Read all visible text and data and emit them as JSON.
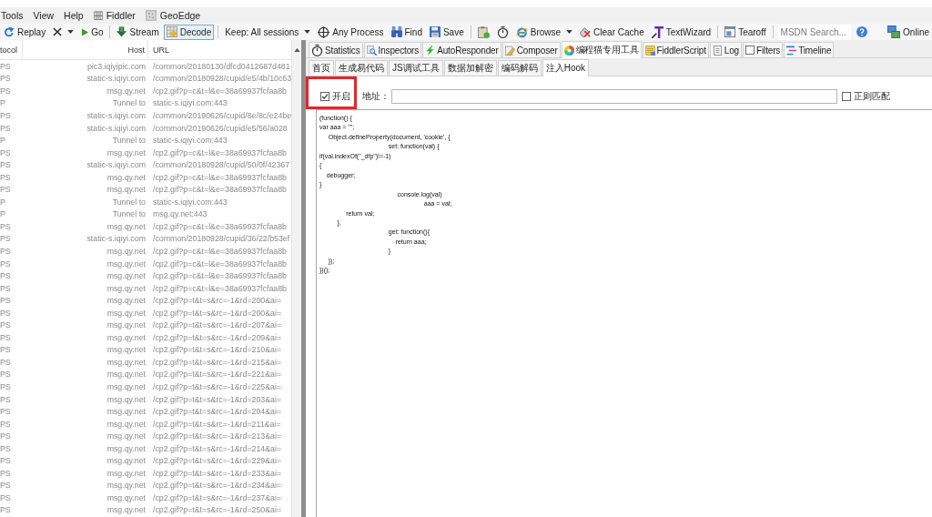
{
  "menu": [
    {
      "label": "Tools"
    },
    {
      "label": "View"
    },
    {
      "label": "Help"
    },
    {
      "label": "Fiddler"
    },
    {
      "label": "GeoEdge"
    }
  ],
  "toolbar": [
    [
      {
        "kind": "button",
        "label": "Replay",
        "pressed": false
      },
      {
        "kind": "menu",
        "pressed": false
      },
      {
        "kind": "button",
        "label": "Go",
        "pressed": false
      }
    ],
    [
      {
        "kind": "button",
        "label": "Stream",
        "pressed": false
      },
      {
        "kind": "button",
        "label": "Decode",
        "pressed": true
      }
    ],
    [
      {
        "kind": "menu",
        "label": "Keep: All sessions",
        "pressed": false
      },
      {
        "kind": "button",
        "label": "Any Process",
        "pressed": false
      },
      {
        "kind": "button",
        "label": "Find",
        "pressed": false
      },
      {
        "kind": "button",
        "label": "Save",
        "pressed": false
      }
    ],
    [
      {
        "kind": "button",
        "pressed": false
      },
      {
        "kind": "button",
        "pressed": false
      },
      {
        "kind": "menu",
        "label": "Browse",
        "pressed": false
      },
      {
        "kind": "button",
        "label": "Clear Cache",
        "pressed": false
      },
      {
        "kind": "button",
        "label": "TextWizard",
        "pressed": false
      }
    ],
    [
      {
        "kind": "button",
        "label": "Tearoff",
        "pressed": false
      }
    ],
    [
      {
        "kind": "search",
        "placeholder": "MSDN Search..."
      },
      {
        "kind": "button",
        "pressed": false
      }
    ]
  ],
  "online": {
    "label": "Online"
  },
  "sessions": {
    "columns": [
      "tocol",
      "Host",
      "URL"
    ],
    "rows": [
      {
        "protocol": "PS",
        "host": "pic3.iqiyipic.com",
        "url": "/common/20180130/dfcd0412687d481"
      },
      {
        "protocol": "PS",
        "host": "static-s.iqiyi.com",
        "url": "/common/20180928/cupid/e5/4b/10c63"
      },
      {
        "protocol": "PS",
        "host": "msg.qy.net",
        "url": "/cp2.gif?p=c&t=l&e=38a69937fcfaa8b"
      },
      {
        "protocol": "P",
        "host": "Tunnel to",
        "url": "static-s.iqiyi.com:443"
      },
      {
        "protocol": "PS",
        "host": "static-s.iqiyi.com",
        "url": "/common/20190626/cupid/8e/8c/e24be"
      },
      {
        "protocol": "PS",
        "host": "static-s.iqiyi.com",
        "url": "/common/20190626/cupid/e5/56/a028"
      },
      {
        "protocol": "P",
        "host": "Tunnel to",
        "url": "static-s.iqiyi.com:443"
      },
      {
        "protocol": "PS",
        "host": "msg.qy.net",
        "url": "/cp2.gif?p=c&t=l&e=38a69937fcfaa8b"
      },
      {
        "protocol": "PS",
        "host": "static-s.iqiyi.com",
        "url": "/common/20180928/cupid/50/0f/42367"
      },
      {
        "protocol": "PS",
        "host": "msg.qy.net",
        "url": "/cp2.gif?p=c&t=l&e=38a69937fcfaa8b"
      },
      {
        "protocol": "PS",
        "host": "msg.qy.net",
        "url": "/cp2.gif?p=c&t=l&e=38a69937fcfaa8b"
      },
      {
        "protocol": "P",
        "host": "Tunnel to",
        "url": "static-s.iqiyi.com:443"
      },
      {
        "protocol": "P",
        "host": "Tunnel to",
        "url": "msg.qy.net:443"
      },
      {
        "protocol": "PS",
        "host": "msg.qy.net",
        "url": "/cp2.gif?p=c&t=l&e=38a69937fcfaa8b"
      },
      {
        "protocol": "PS",
        "host": "static-s.iqiyi.com",
        "url": "/common/20180928/cupid/36/22/b53ef"
      },
      {
        "protocol": "PS",
        "host": "msg.qy.net",
        "url": "/cp2.gif?p=c&t=l&e=38a69937fcfaa8b"
      },
      {
        "protocol": "PS",
        "host": "msg.qy.net",
        "url": "/cp2.gif?p=c&t=l&e=38a69937fcfaa8b"
      },
      {
        "protocol": "PS",
        "host": "msg.qy.net",
        "url": "/cp2.gif?p=c&t=l&e=38a69937fcfaa8b"
      },
      {
        "protocol": "PS",
        "host": "msg.qy.net",
        "url": "/cp2.gif?p=c&t=l&e=38a69937fcfaa8b"
      },
      {
        "protocol": "PS",
        "host": "msg.qy.net",
        "url": "/cp2.gif?p=t&t=s&rc=-1&rd=200&ai="
      },
      {
        "protocol": "PS",
        "host": "msg.qy.net",
        "url": "/cp2.gif?p=t&t=s&rc=-1&rd=200&ai="
      },
      {
        "protocol": "PS",
        "host": "msg.qy.net",
        "url": "/cp2.gif?p=t&t=s&rc=-1&rd=207&ai="
      },
      {
        "protocol": "PS",
        "host": "msg.qy.net",
        "url": "/cp2.gif?p=t&t=s&rc=-1&rd=209&ai="
      },
      {
        "protocol": "PS",
        "host": "msg.qy.net",
        "url": "/cp2.gif?p=t&t=s&rc=-1&rd=210&ai="
      },
      {
        "protocol": "PS",
        "host": "msg.qy.net",
        "url": "/cp2.gif?p=t&t=s&rc=-1&rd=215&ai="
      },
      {
        "protocol": "PS",
        "host": "msg.qy.net",
        "url": "/cp2.gif?p=t&t=s&rc=-1&rd=221&ai="
      },
      {
        "protocol": "PS",
        "host": "msg.qy.net",
        "url": "/cp2.gif?p=t&t=s&rc=-1&rd=225&ai="
      },
      {
        "protocol": "PS",
        "host": "msg.qy.net",
        "url": "/cp2.gif?p=t&t=s&rc=-1&rd=203&ai="
      },
      {
        "protocol": "PS",
        "host": "msg.qy.net",
        "url": "/cp2.gif?p=t&t=s&rc=-1&rd=204&ai="
      },
      {
        "protocol": "PS",
        "host": "msg.qy.net",
        "url": "/cp2.gif?p=t&t=s&rc=-1&rd=211&ai="
      },
      {
        "protocol": "PS",
        "host": "msg.qy.net",
        "url": "/cp2.gif?p=t&t=s&rc=-1&rd=213&ai="
      },
      {
        "protocol": "PS",
        "host": "msg.qy.net",
        "url": "/cp2.gif?p=t&t=s&rc=-1&rd=214&ai="
      },
      {
        "protocol": "PS",
        "host": "msg.qy.net",
        "url": "/cp2.gif?p=t&t=s&rc=-1&rd=229&ai="
      },
      {
        "protocol": "PS",
        "host": "msg.qy.net",
        "url": "/cp2.gif?p=t&t=s&rc=-1&rd=233&ai="
      },
      {
        "protocol": "PS",
        "host": "msg.qy.net",
        "url": "/cp2.gif?p=t&t=s&rc=-1&rd=234&ai="
      },
      {
        "protocol": "PS",
        "host": "msg.qy.net",
        "url": "/cp2.gif?p=t&t=s&rc=-1&rd=237&ai="
      },
      {
        "protocol": "PS",
        "host": "msg.qy.net",
        "url": "/cp2.gif?p=t&t=s&rc=-1&rd=250&ai="
      }
    ]
  },
  "inspector_tabs": [
    {
      "label": "Statistics",
      "selected": false
    },
    {
      "label": "Inspectors",
      "selected": false
    },
    {
      "label": "AutoResponder",
      "selected": false
    },
    {
      "label": "Composer",
      "selected": false
    },
    {
      "label": "编程猫专用工具",
      "selected": true
    },
    {
      "label": "FiddlerScript",
      "selected": false
    },
    {
      "label": "Log",
      "selected": false
    },
    {
      "label": "Filters",
      "selected": false
    },
    {
      "label": "Timeline",
      "selected": false
    }
  ],
  "tool_tabs": [
    {
      "label": "首页",
      "selected": false
    },
    {
      "label": "生成易代码",
      "selected": false
    },
    {
      "label": "JS调试工具",
      "selected": false
    },
    {
      "label": "数据加解密",
      "selected": false
    },
    {
      "label": "编码解码",
      "selected": false
    },
    {
      "label": "注入Hook",
      "selected": true
    }
  ],
  "hook": {
    "enable": {
      "label": "开启",
      "checked": true,
      "highlighted": true
    },
    "address": {
      "label": "地址："
    },
    "regex": {
      "label": "正则匹配",
      "checked": false
    },
    "code": "(function() {\nvar aaa = \"\";\n     Object.defineProperty(document, 'cookie', {\n                                       set: function(val) {\nif(val.indexOf(\"_dfp\")!=-1)\n{\n    debugger;\n}\n                                            console.log(val)\n                                                           aaa = val;\n               return val;\n          },\n                                       get: function(){\n                                           return aaa;\n                                       }\n     });\n})();"
  }
}
